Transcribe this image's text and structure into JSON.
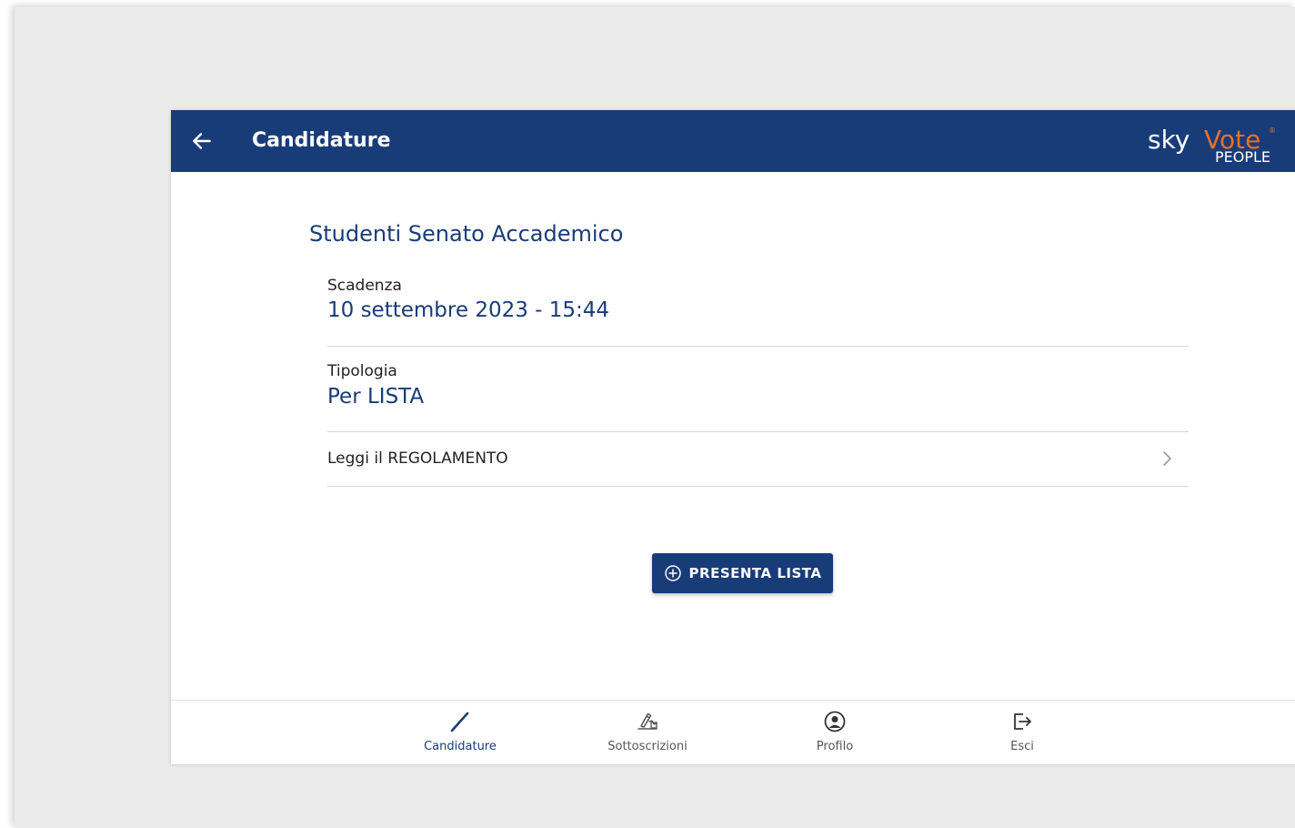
{
  "header": {
    "title": "Candidature",
    "back_icon": "arrow-left-icon",
    "logo": {
      "text_sky": "sky",
      "text_vote": "Vote",
      "text_people": "PEOPLE",
      "text_reg": "®"
    }
  },
  "main": {
    "election_title": "Studenti Senato Accademico",
    "deadline": {
      "label": "Scadenza",
      "value": "10 settembre 2023 - 15:44"
    },
    "type": {
      "label": "Tipologia",
      "value": "Per LISTA"
    },
    "rules": {
      "label": "Leggi il REGOLAMENTO",
      "icon": "chevron-right-icon"
    },
    "present_button": {
      "label": "PRESENTA LISTA",
      "icon": "add-circle-icon"
    }
  },
  "bottom_nav": {
    "items": [
      {
        "label": "Candidature",
        "icon": "pen-icon",
        "active": true
      },
      {
        "label": "Sottoscrizioni",
        "icon": "signature-icon",
        "active": false
      },
      {
        "label": "Profilo",
        "icon": "user-circle-icon",
        "active": false
      },
      {
        "label": "Esci",
        "icon": "logout-icon",
        "active": false
      }
    ]
  },
  "colors": {
    "primary": "#183c78",
    "accent": "#e8702a",
    "background": "#eaeaea",
    "divider": "#d6d6d6"
  }
}
